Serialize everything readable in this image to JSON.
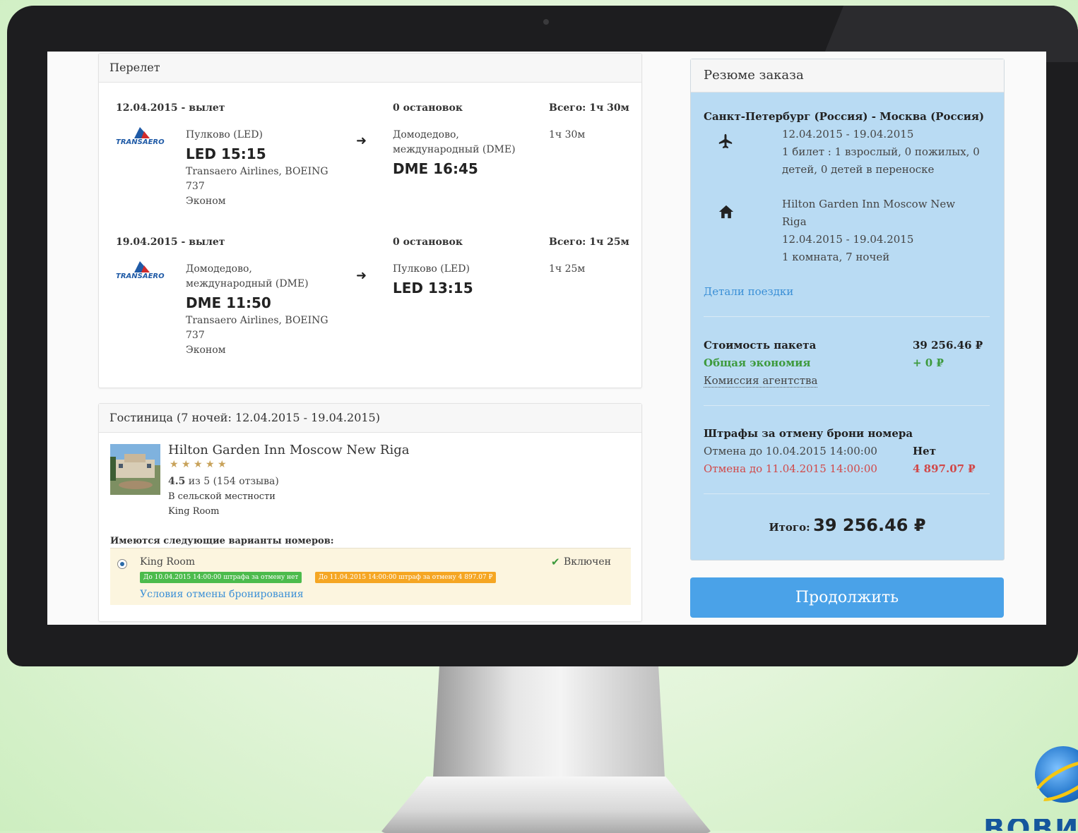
{
  "flight": {
    "header": "Перелет",
    "legs": [
      {
        "date": "12.04.2015 - вылет",
        "stops": "0 остановок",
        "total": "Всего: 1ч 30м",
        "dep_airport": "Пулково (LED)",
        "dep_time": "LED 15:15",
        "airline_line1": "Transaero Airlines, BOEING",
        "airline_line2": "737",
        "class": "Эконом",
        "arr_airport_line1": "Домодедово,",
        "arr_airport_line2": "международный (DME)",
        "arr_time": "DME 16:45",
        "duration": "1ч 30м"
      },
      {
        "date": "19.04.2015 - вылет",
        "stops": "0 остановок",
        "total": "Всего: 1ч 25м",
        "dep_airport_line1": "Домодедово,",
        "dep_airport_line2": "международный (DME)",
        "dep_time": "DME 11:50",
        "airline_line1": "Transaero Airlines, BOEING",
        "airline_line2": "737",
        "class": "Эконом",
        "arr_airport": "Пулково (LED)",
        "arr_time": "LED 13:15",
        "duration": "1ч 25м"
      }
    ],
    "airline_logo_text": "TRANSAERO"
  },
  "hotel": {
    "header": "Гостиница (7 ночей: 12.04.2015 - 19.04.2015)",
    "name": "Hilton Garden Inn Moscow New Riga",
    "stars": "★ ★ ★ ★ ★",
    "rating_value": "4.5",
    "rating_rest": " из 5 (154 отзыва)",
    "location": "В сельской местности",
    "room": "King Room",
    "options_title": "Имеются следующие варианты номеров:",
    "option_room": "King Room",
    "option_status": "Включен",
    "badge_green": "До 10.04.2015 14:00:00 штрафа за отмену нет",
    "badge_orange": "До 11.04.2015 14:00:00 штраф за отмену 4 897.07 ₽",
    "cancel_link": "Условия отмены бронирования"
  },
  "summary": {
    "header": "Резюме заказа",
    "route": "Санкт-Петербург (Россия) - Москва (Россия)",
    "flight_dates": "12.04.2015 - 19.04.2015",
    "tickets_line1": "1 билет : 1 взрослый, 0 пожилых, 0",
    "tickets_line2": "детей, 0 детей в переноске",
    "hotel_line1": "Hilton Garden Inn Moscow New",
    "hotel_line2": "Riga",
    "hotel_dates": "12.04.2015 - 19.04.2015",
    "hotel_rooms": "1 комната, 7 ночей",
    "details_link": "Детали поездки",
    "package_label": "Стоимость пакета",
    "package_value": "39 256.46 ₽",
    "savings_label": "Общая экономия",
    "savings_value": "+ 0 ₽",
    "commission_label": "Комиссия агентства",
    "penalties_title": "Штрафы за отмену брони номера",
    "penalty1_label": "Отмена до 10.04.2015 14:00:00",
    "penalty1_value": "Нет",
    "penalty2_label": "Отмена до 11.04.2015 14:00:00",
    "penalty2_value": "4 897.07 ₽",
    "total_label": "Итого:",
    "total_value": "39 256.46 ₽",
    "continue_label": "Продолжить"
  },
  "brand": {
    "logo_text": "ВОВИ"
  },
  "colors": {
    "summary_bg": "#b9dbf3",
    "primary_button": "#4aa2e8",
    "link": "#3a8fd6",
    "savings_green": "#3d9a3d",
    "penalty_red": "#d14848",
    "badge_green": "#4cbb4c",
    "badge_orange": "#f5a623"
  }
}
